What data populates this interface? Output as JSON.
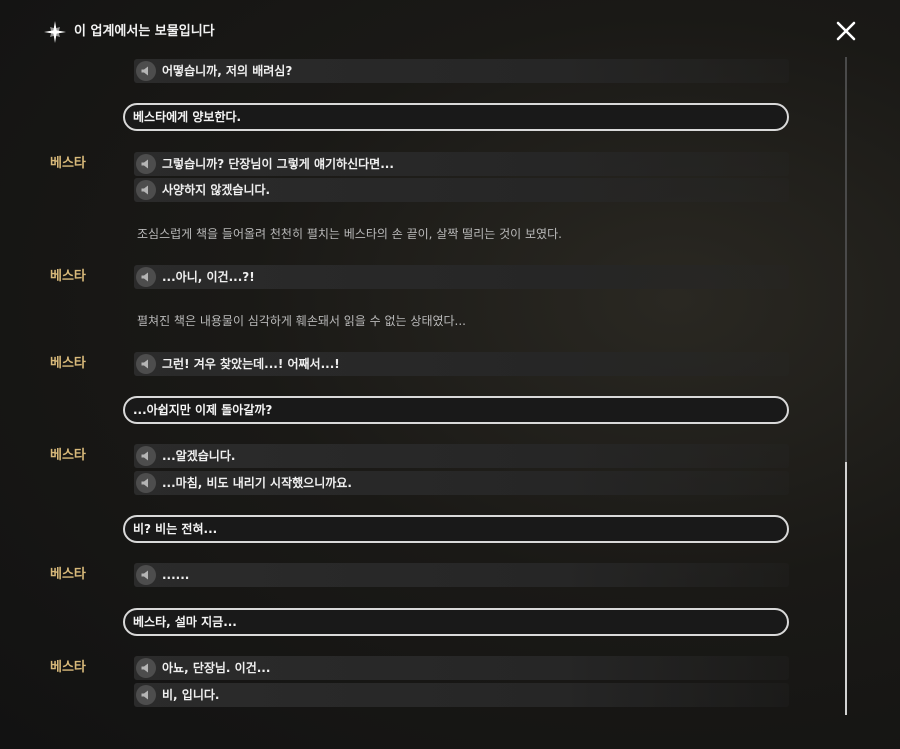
{
  "header": {
    "title": "이 업계에서는 보물입니다",
    "icon": "sparkle-icon",
    "close_icon": "close-icon"
  },
  "colors": {
    "speaker": "#d8b97a",
    "choice_border": "#d9d9d9",
    "background": "#1a1916"
  },
  "log": [
    {
      "type": "voice",
      "speaker": "",
      "text": "어떻습니까, 저의 배려심?"
    },
    {
      "type": "choice",
      "text": "베스타에게 양보한다."
    },
    {
      "type": "voice",
      "speaker": "베스타",
      "text": "그렇습니까? 단장님이 그렇게 얘기하신다면..."
    },
    {
      "type": "voice",
      "speaker": "",
      "text": "사양하지 않겠습니다."
    },
    {
      "type": "narration",
      "text": "조심스럽게 책을 들어올려 천천히 펼치는 베스타의 손 끝이, 살짝 떨리는 것이 보였다."
    },
    {
      "type": "voice",
      "speaker": "베스타",
      "text": "...아니, 이건...?!"
    },
    {
      "type": "narration",
      "text": "펼쳐진 책은 내용물이 심각하게 훼손돼서 읽을 수 없는 상태였다..."
    },
    {
      "type": "voice",
      "speaker": "베스타",
      "text": "그런! 겨우 찾았는데...! 어째서...!"
    },
    {
      "type": "choice",
      "text": "...아쉽지만 이제 돌아갈까?"
    },
    {
      "type": "voice",
      "speaker": "베스타",
      "text": "...알겠습니다."
    },
    {
      "type": "voice",
      "speaker": "",
      "text": "...마침, 비도 내리기 시작했으니까요."
    },
    {
      "type": "choice",
      "text": "비? 비는 전혀..."
    },
    {
      "type": "voice",
      "speaker": "베스타",
      "text": "......"
    },
    {
      "type": "choice",
      "text": "베스타, 설마 지금..."
    },
    {
      "type": "voice",
      "speaker": "베스타",
      "text": "아뇨, 단장님. 이건..."
    },
    {
      "type": "voice",
      "speaker": "",
      "text": "비, 입니다."
    }
  ]
}
